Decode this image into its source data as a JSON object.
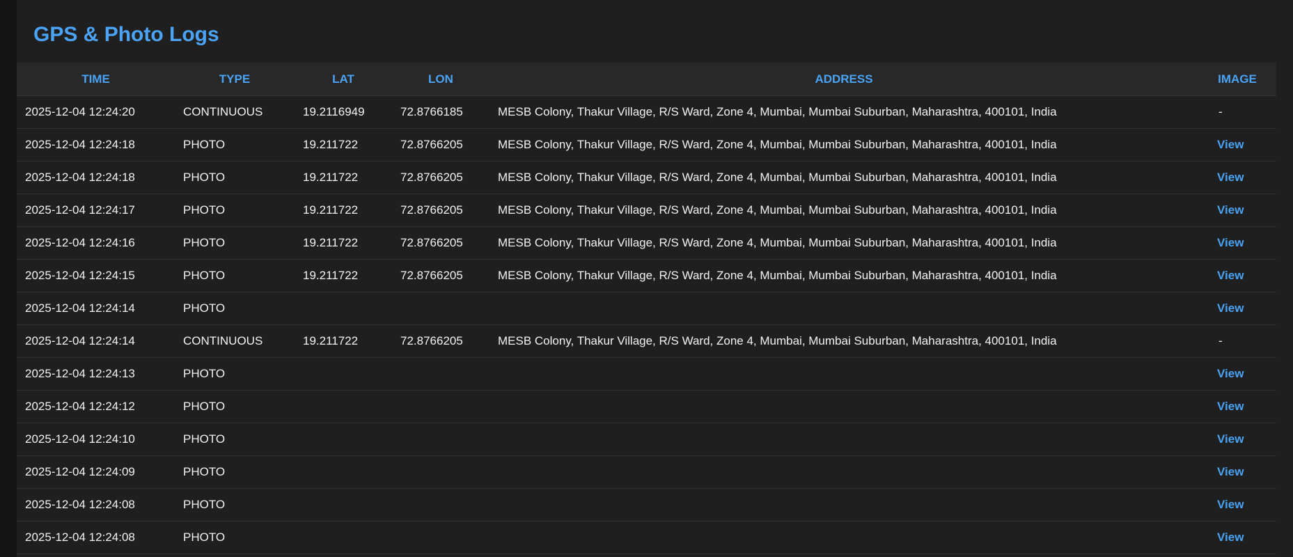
{
  "page": {
    "title": "GPS & Photo Logs"
  },
  "colors": {
    "accent": "#4aa3f5",
    "background": "#1f1f1f",
    "header_row": "#282828",
    "text": "#f2f2f2"
  },
  "table": {
    "headers": [
      "TIME",
      "TYPE",
      "LAT",
      "LON",
      "ADDRESS",
      "IMAGE"
    ],
    "view_label": "View",
    "no_image_label": "-",
    "rows": [
      {
        "time": "2025-12-04 12:24:20",
        "type": "CONTINUOUS",
        "lat": "19.2116949",
        "lon": "72.8766185",
        "address": "MESB Colony, Thakur Village, R/S Ward, Zone 4, Mumbai, Mumbai Suburban, Maharashtra, 400101, India",
        "image": "-"
      },
      {
        "time": "2025-12-04 12:24:18",
        "type": "PHOTO",
        "lat": "19.211722",
        "lon": "72.8766205",
        "address": "MESB Colony, Thakur Village, R/S Ward, Zone 4, Mumbai, Mumbai Suburban, Maharashtra, 400101, India",
        "image": "View"
      },
      {
        "time": "2025-12-04 12:24:18",
        "type": "PHOTO",
        "lat": "19.211722",
        "lon": "72.8766205",
        "address": "MESB Colony, Thakur Village, R/S Ward, Zone 4, Mumbai, Mumbai Suburban, Maharashtra, 400101, India",
        "image": "View"
      },
      {
        "time": "2025-12-04 12:24:17",
        "type": "PHOTO",
        "lat": "19.211722",
        "lon": "72.8766205",
        "address": "MESB Colony, Thakur Village, R/S Ward, Zone 4, Mumbai, Mumbai Suburban, Maharashtra, 400101, India",
        "image": "View"
      },
      {
        "time": "2025-12-04 12:24:16",
        "type": "PHOTO",
        "lat": "19.211722",
        "lon": "72.8766205",
        "address": "MESB Colony, Thakur Village, R/S Ward, Zone 4, Mumbai, Mumbai Suburban, Maharashtra, 400101, India",
        "image": "View"
      },
      {
        "time": "2025-12-04 12:24:15",
        "type": "PHOTO",
        "lat": "19.211722",
        "lon": "72.8766205",
        "address": "MESB Colony, Thakur Village, R/S Ward, Zone 4, Mumbai, Mumbai Suburban, Maharashtra, 400101, India",
        "image": "View"
      },
      {
        "time": "2025-12-04 12:24:14",
        "type": "PHOTO",
        "lat": "",
        "lon": "",
        "address": "",
        "image": "View"
      },
      {
        "time": "2025-12-04 12:24:14",
        "type": "CONTINUOUS",
        "lat": "19.211722",
        "lon": "72.8766205",
        "address": "MESB Colony, Thakur Village, R/S Ward, Zone 4, Mumbai, Mumbai Suburban, Maharashtra, 400101, India",
        "image": "-"
      },
      {
        "time": "2025-12-04 12:24:13",
        "type": "PHOTO",
        "lat": "",
        "lon": "",
        "address": "",
        "image": "View"
      },
      {
        "time": "2025-12-04 12:24:12",
        "type": "PHOTO",
        "lat": "",
        "lon": "",
        "address": "",
        "image": "View"
      },
      {
        "time": "2025-12-04 12:24:10",
        "type": "PHOTO",
        "lat": "",
        "lon": "",
        "address": "",
        "image": "View"
      },
      {
        "time": "2025-12-04 12:24:09",
        "type": "PHOTO",
        "lat": "",
        "lon": "",
        "address": "",
        "image": "View"
      },
      {
        "time": "2025-12-04 12:24:08",
        "type": "PHOTO",
        "lat": "",
        "lon": "",
        "address": "",
        "image": "View"
      },
      {
        "time": "2025-12-04 12:24:08",
        "type": "PHOTO",
        "lat": "",
        "lon": "",
        "address": "",
        "image": "View"
      }
    ]
  }
}
